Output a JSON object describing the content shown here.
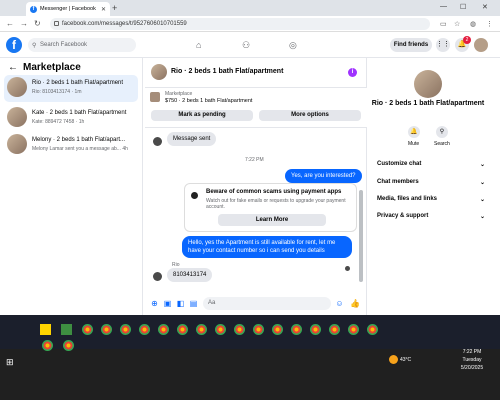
{
  "browser": {
    "tab_title": "Messenger | Facebook",
    "url": "facebook.com/messages/t/9527606010701559"
  },
  "fbnav": {
    "search_placeholder": "Search Facebook",
    "find_friends": "Find friends",
    "notif_count": "2"
  },
  "left": {
    "heading": "Marketplace",
    "conversations": [
      {
        "title": "Rio · 2 beds 1 bath Flat/apartment",
        "sub": "Rio: 8103413174 · 1m"
      },
      {
        "title": "Kate · 2 beds 1 bath Flat/apartment",
        "sub": "Kate: 889472 7458 · 1h"
      },
      {
        "title": "Melony · 2 beds 1 bath Flat/apart...",
        "sub": "Melony Lamar sent you a message ab...   4h"
      }
    ]
  },
  "chat": {
    "title": "Rio · 2 beds 1 bath Flat/apartment",
    "listing_label": "Marketplace",
    "listing_price": "$750 · 2 beds 1 bath Flat/apartment",
    "mark_pending": "Mark as pending",
    "more_options": "More options",
    "msg_sent": "Message sent",
    "time": "7:22 PM",
    "out1": "Yes, are you interested?",
    "scam_title": "Beware of common scams using payment apps",
    "scam_sub": "Watch out for fake emails or requests to upgrade your payment account.",
    "learn_more": "Learn More",
    "out2": "Hello, yes the Apartment is still available for rent, let me have your contact number so i can send you details",
    "sender": "Rio",
    "in_last": "8103413174",
    "composer_placeholder": "Aa"
  },
  "right": {
    "name": "Rio · 2 beds 1 bath Flat/apartment",
    "mute": "Mute",
    "search": "Search",
    "sections": [
      "Customize chat",
      "Chat members",
      "Media, files and links",
      "Privacy & support"
    ]
  },
  "tray": {
    "weather": "43°C",
    "time": "7:22 PM",
    "day": "Tuesday",
    "date": "5/20/2025"
  }
}
